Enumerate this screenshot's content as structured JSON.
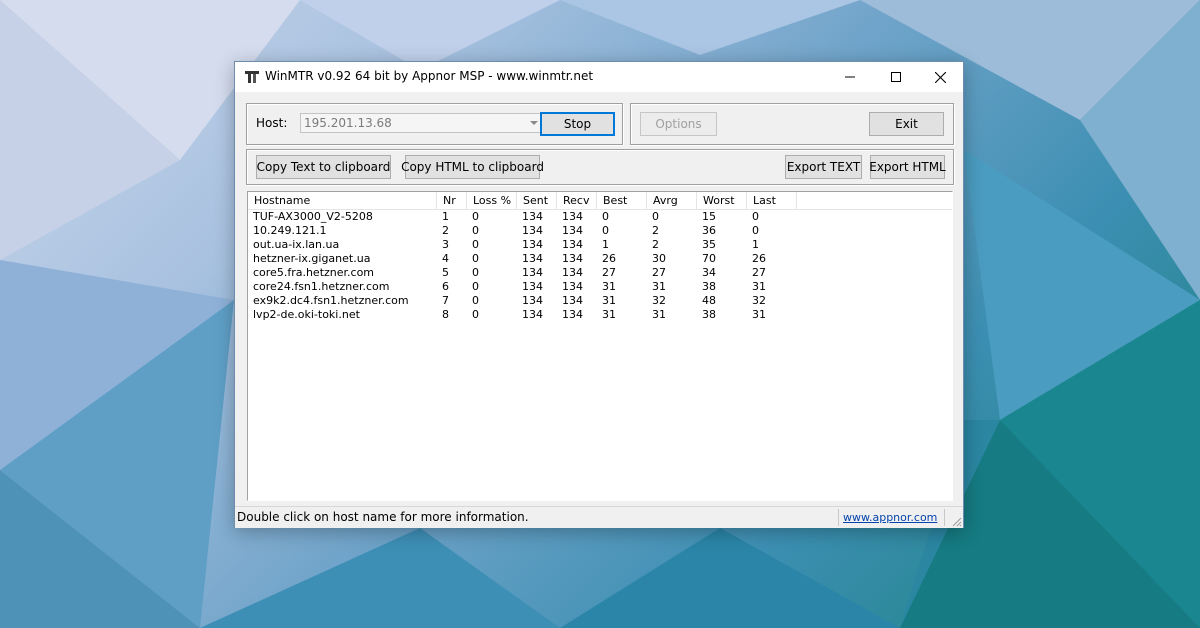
{
  "window": {
    "title": "WinMTR v0.92 64 bit by Appnor MSP - www.winmtr.net"
  },
  "host": {
    "label": "Host:",
    "value": "195.201.13.68"
  },
  "buttons": {
    "stop": "Stop",
    "options": "Options",
    "exit": "Exit",
    "copy_text": "Copy Text to clipboard",
    "copy_html": "Copy HTML to clipboard",
    "export_text": "Export TEXT",
    "export_html": "Export HTML"
  },
  "table": {
    "columns": [
      "Hostname",
      "Nr",
      "Loss %",
      "Sent",
      "Recv",
      "Best",
      "Avrg",
      "Worst",
      "Last"
    ],
    "rows": [
      [
        "TUF-AX3000_V2-5208",
        "1",
        "0",
        "134",
        "134",
        "0",
        "0",
        "15",
        "0"
      ],
      [
        "10.249.121.1",
        "2",
        "0",
        "134",
        "134",
        "0",
        "2",
        "36",
        "0"
      ],
      [
        "out.ua-ix.lan.ua",
        "3",
        "0",
        "134",
        "134",
        "1",
        "2",
        "35",
        "1"
      ],
      [
        "hetzner-ix.giganet.ua",
        "4",
        "0",
        "134",
        "134",
        "26",
        "30",
        "70",
        "26"
      ],
      [
        "core5.fra.hetzner.com",
        "5",
        "0",
        "134",
        "134",
        "27",
        "27",
        "34",
        "27"
      ],
      [
        "core24.fsn1.hetzner.com",
        "6",
        "0",
        "134",
        "134",
        "31",
        "31",
        "38",
        "31"
      ],
      [
        "ex9k2.dc4.fsn1.hetzner.com",
        "7",
        "0",
        "134",
        "134",
        "31",
        "32",
        "48",
        "32"
      ],
      [
        "lvp2-de.oki-toki.net",
        "8",
        "0",
        "134",
        "134",
        "31",
        "31",
        "38",
        "31"
      ]
    ]
  },
  "status": {
    "text": "Double click on host name for more information.",
    "link": "www.appnor.com"
  },
  "icons": {
    "app": "winmtr-app-icon",
    "minimize": "minimize-icon",
    "maximize": "maximize-icon",
    "close": "close-icon",
    "dropdown": "chevron-down-icon",
    "grip": "resize-grip-icon"
  }
}
